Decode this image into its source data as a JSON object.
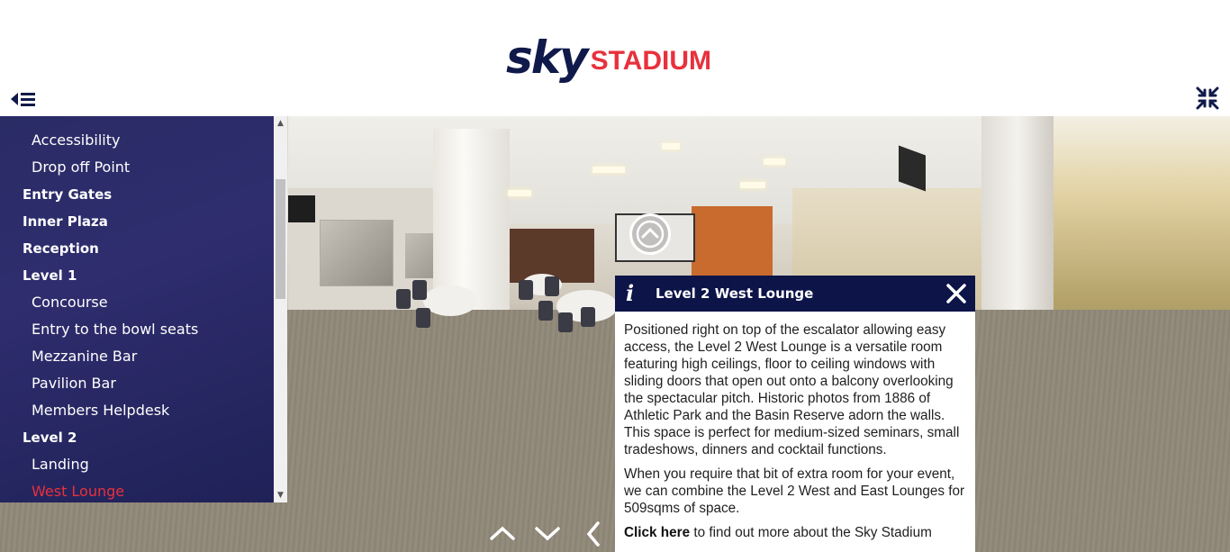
{
  "header": {
    "logo_sky": "sky",
    "logo_stadium": "STADIUM",
    "menu_toggle_icon": "menu-collapse-icon",
    "fullscreen_icon": "fullscreen-exit-icon"
  },
  "sidebar": {
    "items": [
      {
        "label": "Accessibility",
        "level": 2
      },
      {
        "label": "Drop off Point",
        "level": 2
      },
      {
        "label": "Entry Gates",
        "level": 1
      },
      {
        "label": "Inner Plaza",
        "level": 1
      },
      {
        "label": "Reception",
        "level": 1
      },
      {
        "label": "Level 1",
        "level": 1
      },
      {
        "label": "Concourse",
        "level": 2
      },
      {
        "label": "Entry to the bowl seats",
        "level": 2
      },
      {
        "label": "Mezzanine Bar",
        "level": 2
      },
      {
        "label": "Pavilion Bar",
        "level": 2
      },
      {
        "label": "Members Helpdesk",
        "level": 2
      },
      {
        "label": "Level 2",
        "level": 1
      },
      {
        "label": "Landing",
        "level": 2
      },
      {
        "label": "West Lounge",
        "level": 2,
        "active": true
      }
    ]
  },
  "info": {
    "icon": "i",
    "title": "Level 2 West Lounge",
    "paragraph1": "Positioned right on top of the escalator allowing easy access, the Level 2 West Lounge is a versatile room featuring high ceilings, floor to ceiling windows with sliding doors that open out onto a balcony overlooking the spectacular pitch. Historic photos from 1886 of Athletic Park and the Basin Reserve adorn the walls. This space is perfect for medium-sized seminars, small tradeshows, dinners and cocktail functions.",
    "paragraph2": "When you require that bit of extra room for your event, we can combine the Level 2 West and East Lounges for 509sqms of space.",
    "link_text": "Click here",
    "link_rest": " to find out more about the Sky Stadium"
  },
  "colors": {
    "brand_navy": "#101a4a",
    "brand_red": "#e8313d",
    "panel_header": "#0c1448"
  }
}
